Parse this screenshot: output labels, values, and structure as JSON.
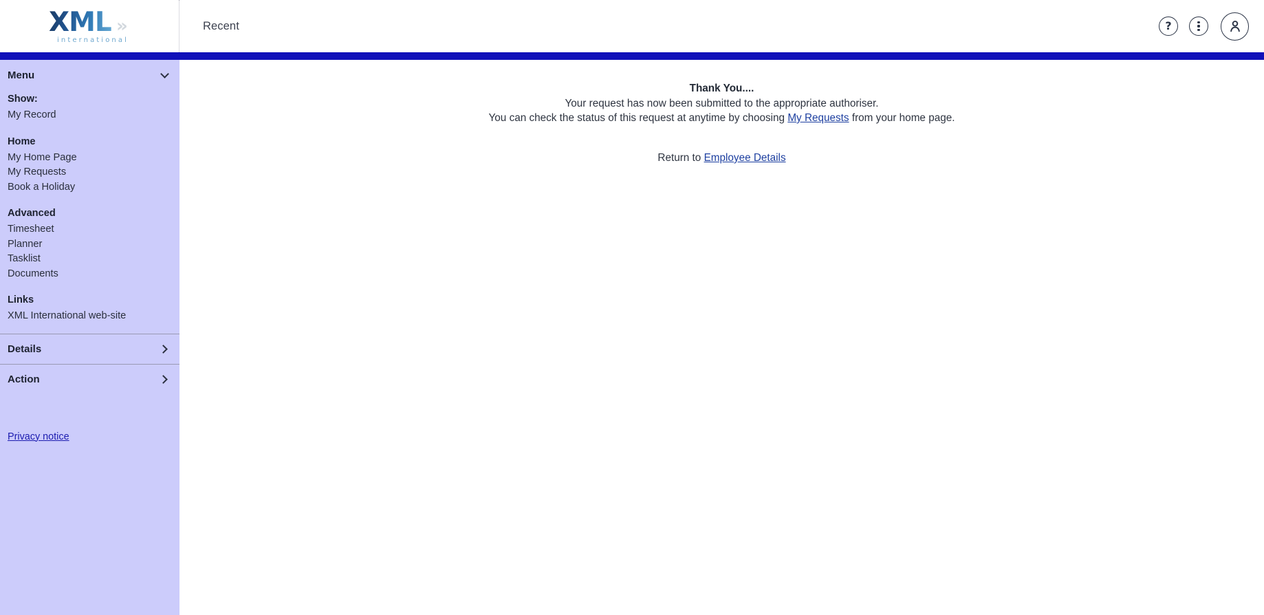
{
  "header": {
    "logo": {
      "main_text": "XML",
      "chevron": "»",
      "subtitle": "international",
      "icon_name": "xml-international-logo"
    },
    "title": "Recent",
    "actions": {
      "help_label": "?",
      "help_icon": "help-question-icon",
      "more_icon": "more-vertical-dots-icon",
      "avatar_icon": "user-avatar-icon"
    }
  },
  "sidebar": {
    "menu_header": "Menu",
    "menu_chevron_icon": "chevron-down-icon",
    "groups": [
      {
        "title": "Show:",
        "items": [
          "My Record"
        ]
      },
      {
        "title": "Home",
        "items": [
          "My Home Page",
          "My Requests",
          "Book a Holiday"
        ]
      },
      {
        "title": "Advanced",
        "items": [
          "Timesheet",
          "Planner",
          "Tasklist",
          "Documents"
        ]
      },
      {
        "title": "Links",
        "items": [
          "XML International web-site"
        ]
      }
    ],
    "details_header": "Details",
    "details_chevron_icon": "chevron-right-icon",
    "action_header": "Action",
    "action_chevron_icon": "chevron-right-icon",
    "privacy_label": "Privacy notice"
  },
  "main": {
    "title": "Thank You....",
    "line1": "Your request has now been submitted to the appropriate authoriser.",
    "line2_before": "You can check the status of this request at anytime by choosing ",
    "line2_link": "My Requests",
    "line2_after": " from your home page.",
    "return_prefix": "Return to ",
    "return_link": "Employee Details"
  },
  "colors": {
    "sidebar_bg": "#CCCCFB",
    "blue_bar": "#1010B9",
    "link": "#1D3FA0",
    "privacy_link": "#1C1CB0",
    "text": "#2E3440"
  }
}
